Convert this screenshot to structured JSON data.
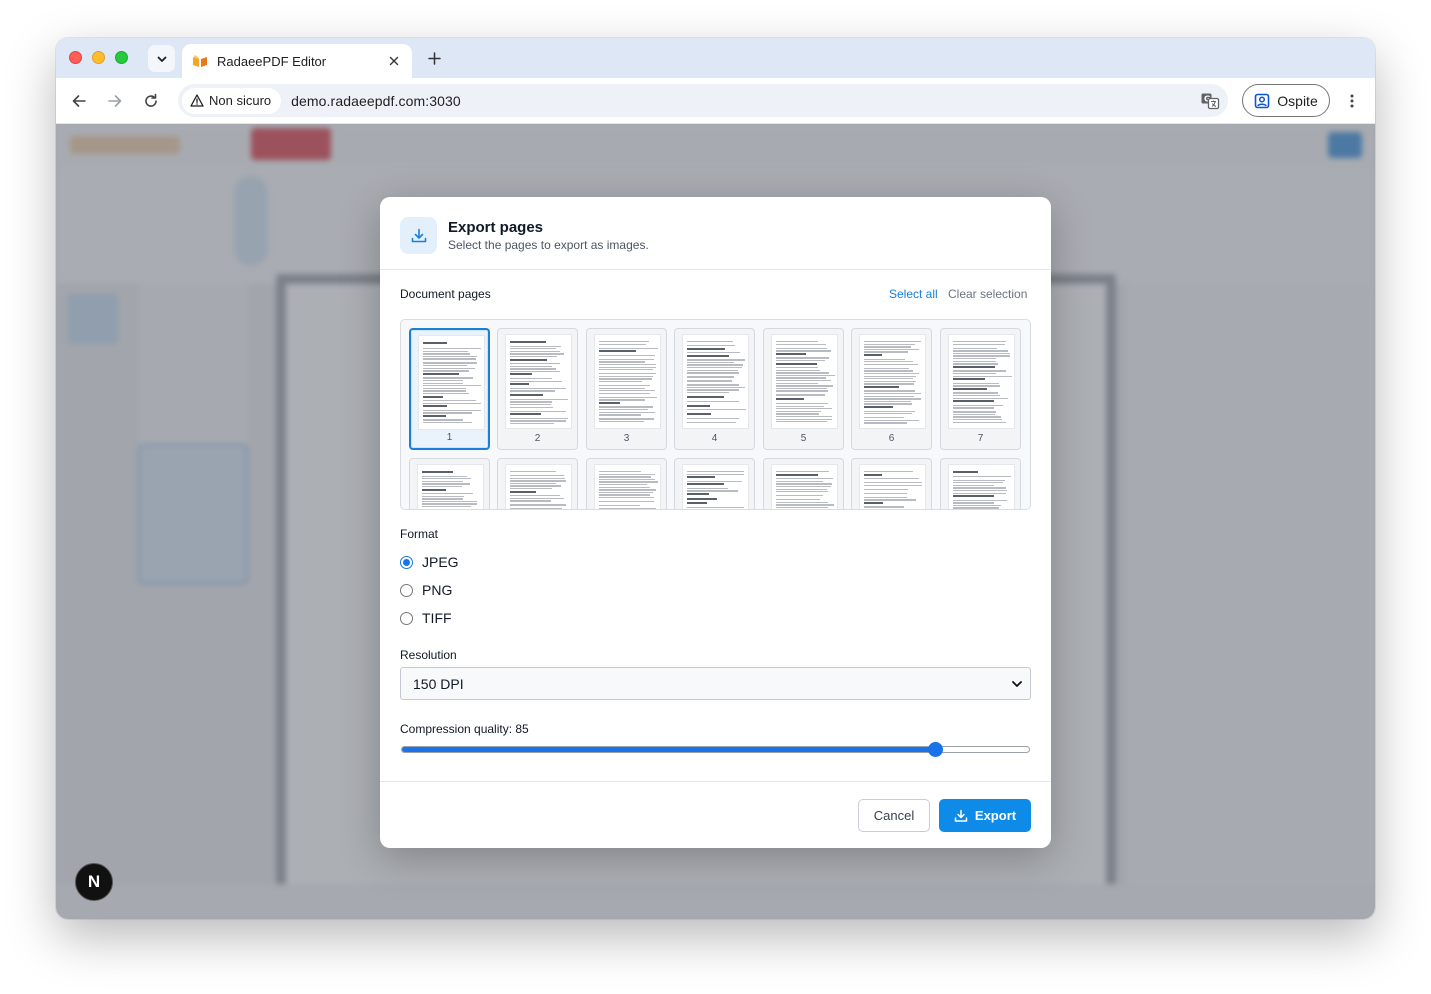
{
  "browser": {
    "tab_title": "RadaeePDF Editor",
    "security_label": "Non sicuro",
    "url": "demo.radaeepdf.com:3030",
    "profile_label": "Ospite"
  },
  "dialog": {
    "title": "Export pages",
    "subtitle": "Select the pages to export as images.",
    "pages_section_label": "Document pages",
    "select_all_label": "Select all",
    "clear_selection_label": "Clear selection",
    "pages": [
      {
        "number": "1",
        "selected": true
      },
      {
        "number": "2",
        "selected": false
      },
      {
        "number": "3",
        "selected": false
      },
      {
        "number": "4",
        "selected": false
      },
      {
        "number": "5",
        "selected": false
      },
      {
        "number": "6",
        "selected": false
      },
      {
        "number": "7",
        "selected": false
      }
    ],
    "format_label": "Format",
    "format_options": [
      "JPEG",
      "PNG",
      "TIFF"
    ],
    "format_selected": "JPEG",
    "resolution_label": "Resolution",
    "resolution_value": "150 DPI",
    "compression_label": "Compression quality: 85",
    "compression_value": 85,
    "compression_max": 100,
    "cancel_label": "Cancel",
    "export_label": "Export"
  },
  "colors": {
    "accent": "#1a7fd6",
    "export_button": "#0e8ae8",
    "slider": "#1a73e8"
  },
  "icons": {
    "header": "download-icon",
    "export_button": "download-icon",
    "framework_badge": "next-logo-icon"
  }
}
